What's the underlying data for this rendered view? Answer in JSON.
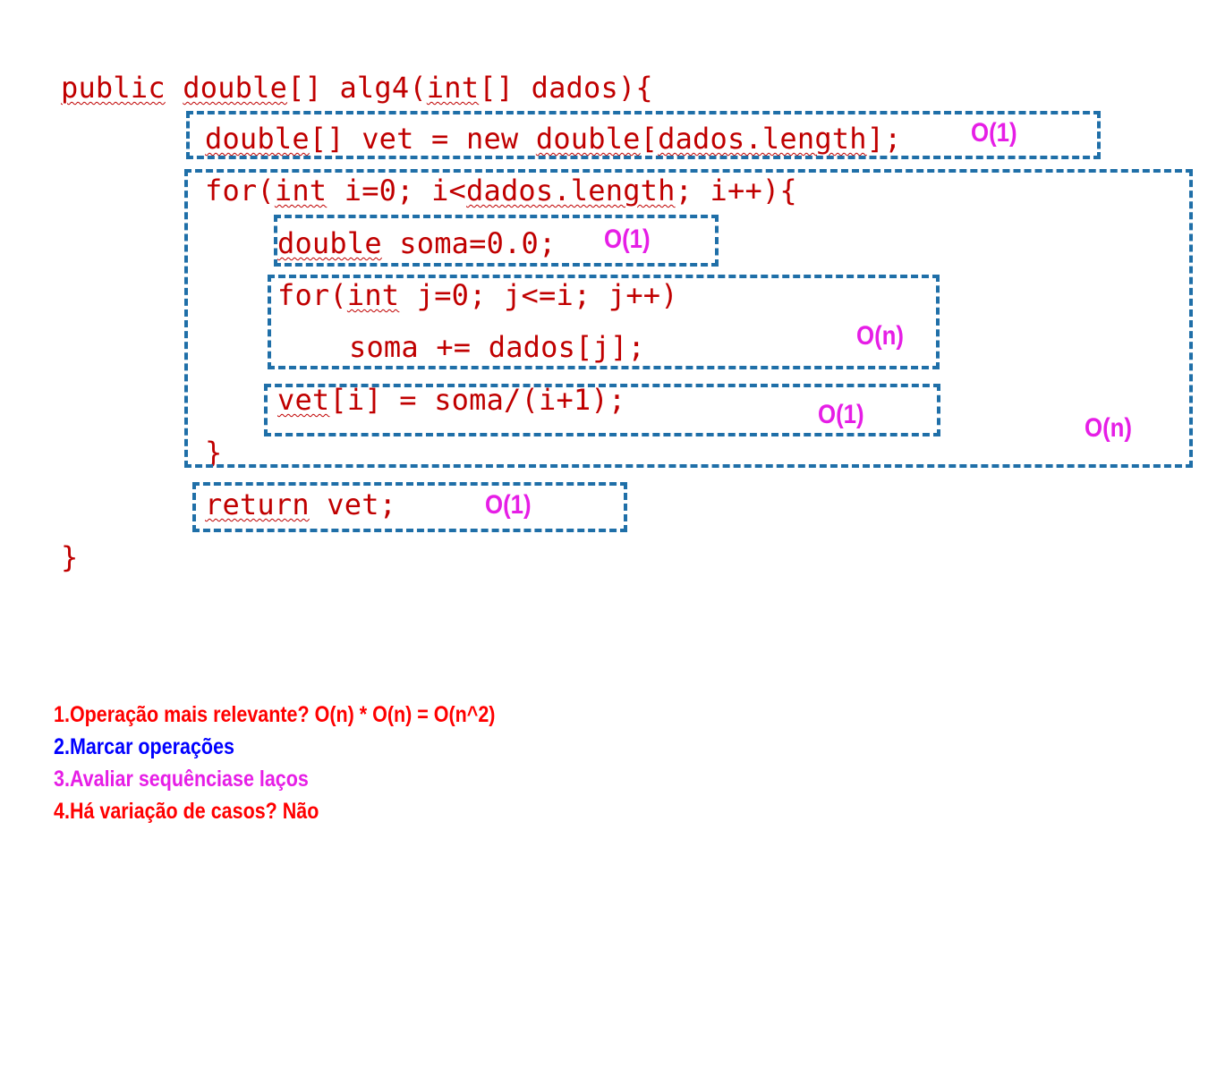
{
  "code": {
    "l1": {
      "a": "public",
      "b": " ",
      "c": "double",
      "d": "[] alg4(",
      "e": "int",
      "f": "[] dados){"
    },
    "l2": {
      "a": "double",
      "b": "[] vet = new ",
      "c": "double",
      "d": "[",
      "e": "dados.length",
      "f": "];"
    },
    "l3": {
      "a": "for(",
      "b": "int",
      "c": " i=0; i<",
      "d": "dados.length",
      "e": "; i++){"
    },
    "l4": {
      "a": "double",
      "b": " soma=0.0;"
    },
    "l5": {
      "a": "for(",
      "b": "int",
      "c": " j=0; j<=i; j++)"
    },
    "l6": "soma += dados[j];",
    "l7": {
      "a": "vet",
      "b": "[i] = soma/(i+1);"
    },
    "l8": "}",
    "l9": {
      "a": "return",
      "b": " vet;"
    },
    "l10": "}"
  },
  "complexity": {
    "vet_alloc": "O(1)",
    "soma_init": "O(1)",
    "inner_loop": "O(n)",
    "vet_assign": "O(1)",
    "outer_loop": "O(n)",
    "return": "O(1)"
  },
  "steps": [
    {
      "number": "1.",
      "text": "Operação mais relevante? O(n) * O(n) = O(n^2)",
      "number_color": "#ff0000",
      "text_color": "#ff0000"
    },
    {
      "number": "2.",
      "text": "Marcar operações",
      "number_color": "#0000ff",
      "text_color": "#0000ff"
    },
    {
      "number": "3.",
      "text": "Avaliar sequênciase laços",
      "number_color": "#e61ee6",
      "text_color": "#e61ee6"
    },
    {
      "number": "4.",
      "text": "Há variação de casos? Não",
      "number_color": "#ff0000",
      "text_color": "#ff0000"
    }
  ],
  "colors": {
    "code": "#c00000",
    "box_border": "#1f6fa8",
    "complexity_label": "#e61ee6"
  }
}
